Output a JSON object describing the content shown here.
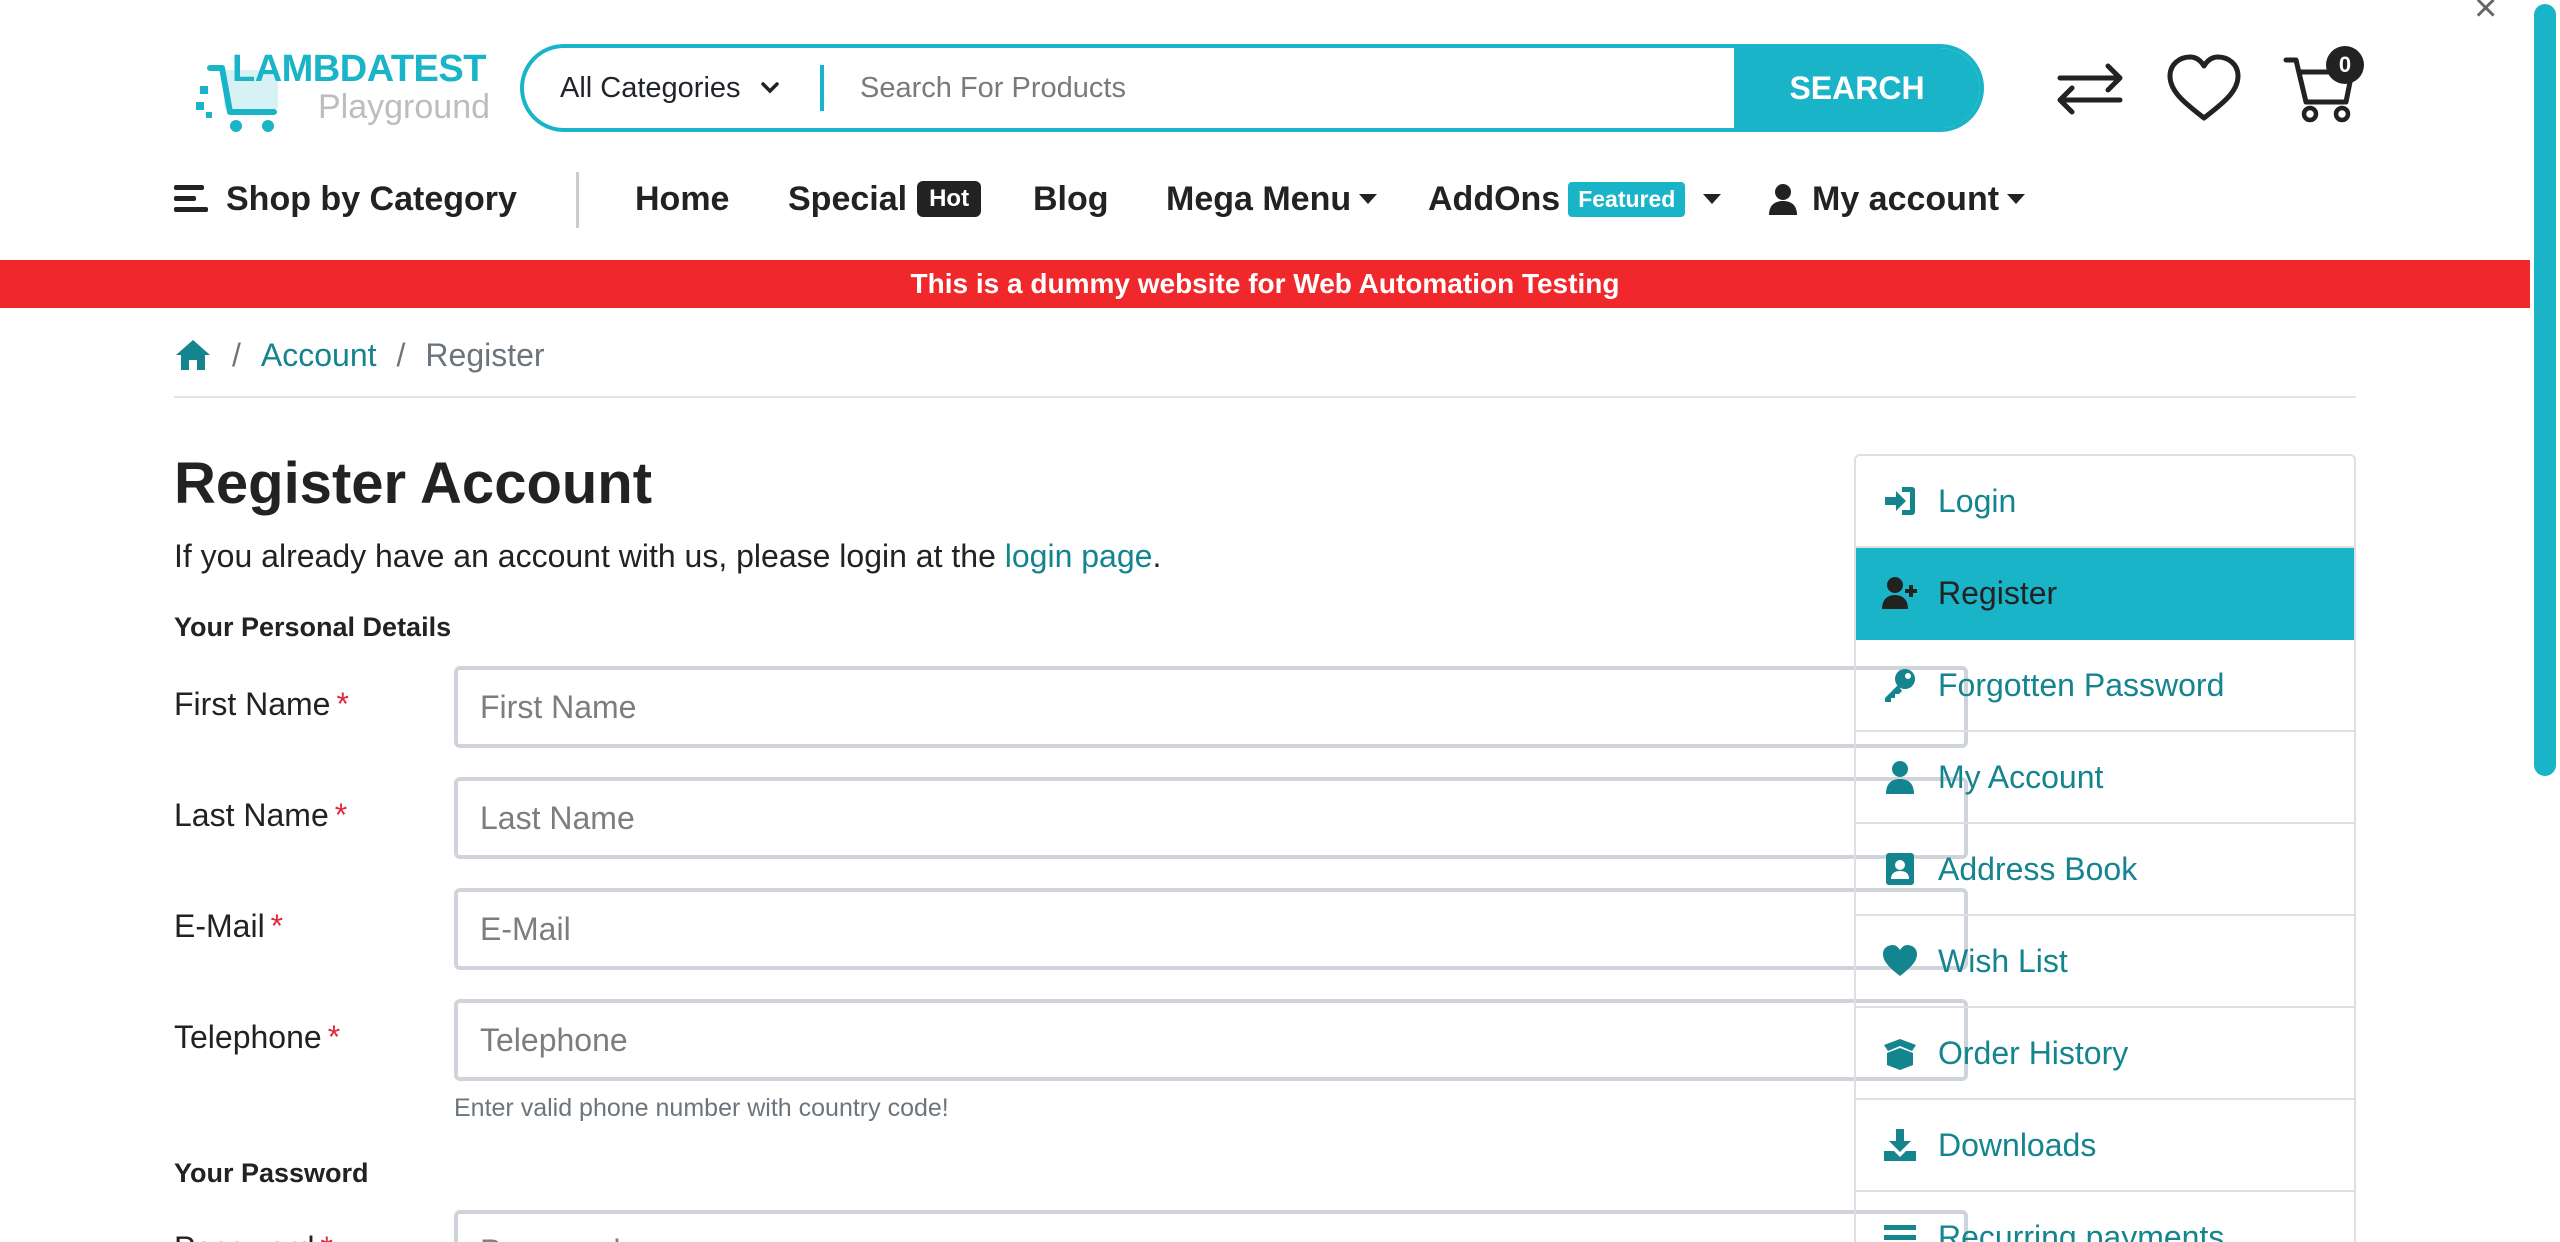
{
  "header": {
    "logo": {
      "top": "LAMBDATEST",
      "bottom": "Playground"
    },
    "search": {
      "category": "All Categories",
      "placeholder": "Search For Products",
      "button": "SEARCH"
    },
    "icons": [
      "compare-icon",
      "wishlist-heart-icon",
      "cart-icon"
    ],
    "cart_count": "0"
  },
  "nav": {
    "shop_by_category": "Shop by Category",
    "home": "Home",
    "special": "Special",
    "special_badge": "Hot",
    "blog": "Blog",
    "mega_menu": "Mega Menu",
    "addons": "AddOns",
    "addons_badge": "Featured",
    "my_account": "My account"
  },
  "alert": "This is a dummy website for Web Automation Testing",
  "breadcrumb": {
    "separator": "/",
    "account": "Account",
    "current": "Register"
  },
  "form": {
    "title": "Register Account",
    "intro_prefix": "If you already have an account with us, please login at the ",
    "intro_link": "login page",
    "intro_suffix": ".",
    "personal_legend": "Your Personal Details",
    "required_mark": "*",
    "fields": [
      {
        "label": "First Name",
        "placeholder": "First Name"
      },
      {
        "label": "Last Name",
        "placeholder": "Last Name"
      },
      {
        "label": "E-Mail",
        "placeholder": "E-Mail"
      },
      {
        "label": "Telephone",
        "placeholder": "Telephone"
      }
    ],
    "telephone_help": "Enter valid phone number with country code!",
    "password_legend": "Your Password",
    "password": {
      "label": "Password",
      "placeholder": "Password"
    }
  },
  "sidebar": {
    "items": [
      {
        "label": "Login",
        "icon": "sign-in-icon"
      },
      {
        "label": "Register",
        "icon": "user-plus-icon",
        "active": true
      },
      {
        "label": "Forgotten Password",
        "icon": "key-icon"
      },
      {
        "label": "My Account",
        "icon": "user-icon"
      },
      {
        "label": "Address Book",
        "icon": "address-book-icon"
      },
      {
        "label": "Wish List",
        "icon": "heart-icon"
      },
      {
        "label": "Order History",
        "icon": "box-open-icon"
      },
      {
        "label": "Downloads",
        "icon": "download-icon"
      },
      {
        "label": "Recurring payments",
        "icon": "bars-icon"
      }
    ]
  },
  "colors": {
    "accent": "#19b4c8",
    "link": "#14848f",
    "alert": "#f0282b",
    "required": "#e0283c"
  }
}
